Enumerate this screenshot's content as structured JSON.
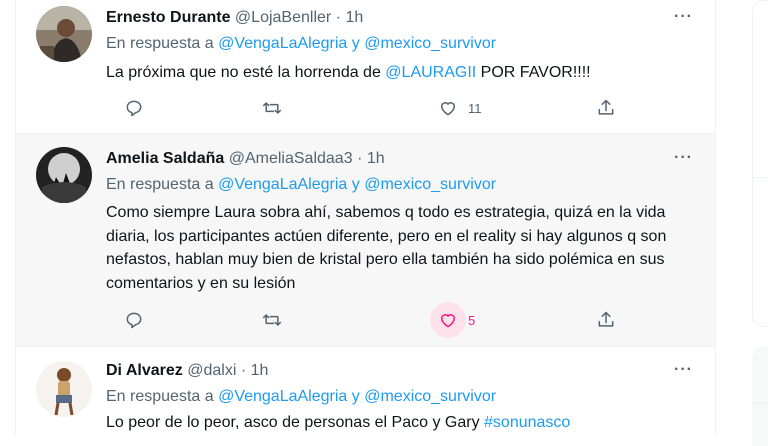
{
  "tweets": [
    {
      "name": "Ernesto Durante",
      "handle": "@LojaBenller",
      "time": "· 1h",
      "reply_prefix": "En respuesta a",
      "reply_to1": "@VengaLaAlegria",
      "reply_and": "y",
      "reply_to2": "@mexico_survivor",
      "text_before": "La próxima que no esté la horrenda de ",
      "mention": "@LAURAGII",
      "text_after": " POR FAVOR!!!!",
      "like_count": "11",
      "liked": false
    },
    {
      "name": "Amelia Saldaña",
      "handle": "@AmeliaSaldaa3",
      "time": "· 1h",
      "reply_prefix": "En respuesta a",
      "reply_to1": "@VengaLaAlegria",
      "reply_and": "y",
      "reply_to2": "@mexico_survivor",
      "text": "Como siempre Laura sobra ahí, sabemos q todo es estrategia, quizá en la vida diaria, los participantes actúen diferente, pero en el reality si hay algunos q son nefastos, hablan muy bien de kristal pero ella también ha sido polémica en sus comentarios y en su lesión",
      "like_count": "5",
      "liked": true
    },
    {
      "name": "Di Alvarez",
      "handle": "@dalxi",
      "time": "· 1h",
      "reply_prefix": "En respuesta a",
      "reply_to1": "@VengaLaAlegria",
      "reply_and": "y",
      "reply_to2": "@mexico_survivor",
      "text_before": "Lo peor de lo peor, asco de personas el Paco y Gary ",
      "hashtag": "#sonunasco"
    }
  ],
  "more_label": "···",
  "colors": {
    "link": "#1d9bf0",
    "like": "#f91880",
    "muted": "#536471"
  },
  "icons": [
    "reply-icon",
    "retweet-icon",
    "like-icon",
    "share-icon",
    "more-icon"
  ]
}
